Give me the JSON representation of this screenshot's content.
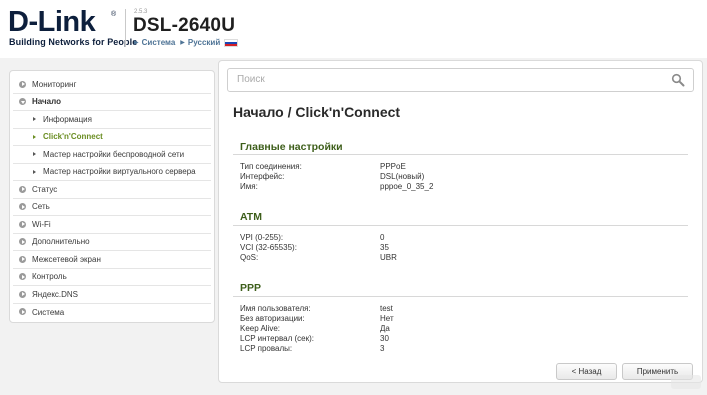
{
  "header": {
    "brand": "D-Link",
    "reg_mark": "®",
    "tagline": "Building Networks for People",
    "fw_version": "2.5.3",
    "model": "DSL-2640U",
    "system_link": "Система",
    "language_link": "Русский"
  },
  "sidebar": {
    "items": [
      {
        "label": "Мониторинг",
        "type": "top"
      },
      {
        "label": "Начало",
        "type": "top",
        "open": true
      },
      {
        "label": "Информация",
        "type": "sub"
      },
      {
        "label": "Click'n'Connect",
        "type": "sub",
        "active": true
      },
      {
        "label": "Мастер настройки беспроводной сети",
        "type": "sub"
      },
      {
        "label": "Мастер настройки виртуального сервера",
        "type": "sub"
      },
      {
        "label": "Статус",
        "type": "top"
      },
      {
        "label": "Сеть",
        "type": "top"
      },
      {
        "label": "Wi-Fi",
        "type": "top"
      },
      {
        "label": "Дополнительно",
        "type": "top"
      },
      {
        "label": "Межсетевой экран",
        "type": "top"
      },
      {
        "label": "Контроль",
        "type": "top"
      },
      {
        "label": "Яндекс.DNS",
        "type": "top"
      },
      {
        "label": "Система",
        "type": "top"
      }
    ]
  },
  "search": {
    "placeholder": "Поиск"
  },
  "page": {
    "title": "Начало /  Click'n'Connect"
  },
  "sections": {
    "main": {
      "title": "Главные настройки",
      "rows": [
        {
          "key": "Тип соединения:",
          "value": "PPPoE"
        },
        {
          "key": "Интерфейс:",
          "value": "DSL(новый)"
        },
        {
          "key": "Имя:",
          "value": "pppoe_0_35_2"
        }
      ]
    },
    "atm": {
      "title": "ATM",
      "rows": [
        {
          "key": "VPI (0-255):",
          "value": "0"
        },
        {
          "key": "VCI (32-65535):",
          "value": "35"
        },
        {
          "key": "QoS:",
          "value": "UBR"
        }
      ]
    },
    "ppp": {
      "title": "PPP",
      "rows": [
        {
          "key": "Имя пользователя:",
          "value": "test"
        },
        {
          "key": "Без авторизации:",
          "value": "Нет"
        },
        {
          "key": "Keep Alive:",
          "value": "Да"
        },
        {
          "key": "LCP интервал (сек):",
          "value": "30"
        },
        {
          "key": "LCP провалы:",
          "value": "3"
        }
      ]
    }
  },
  "buttons": {
    "back": "< Назад",
    "apply": "Применить"
  }
}
